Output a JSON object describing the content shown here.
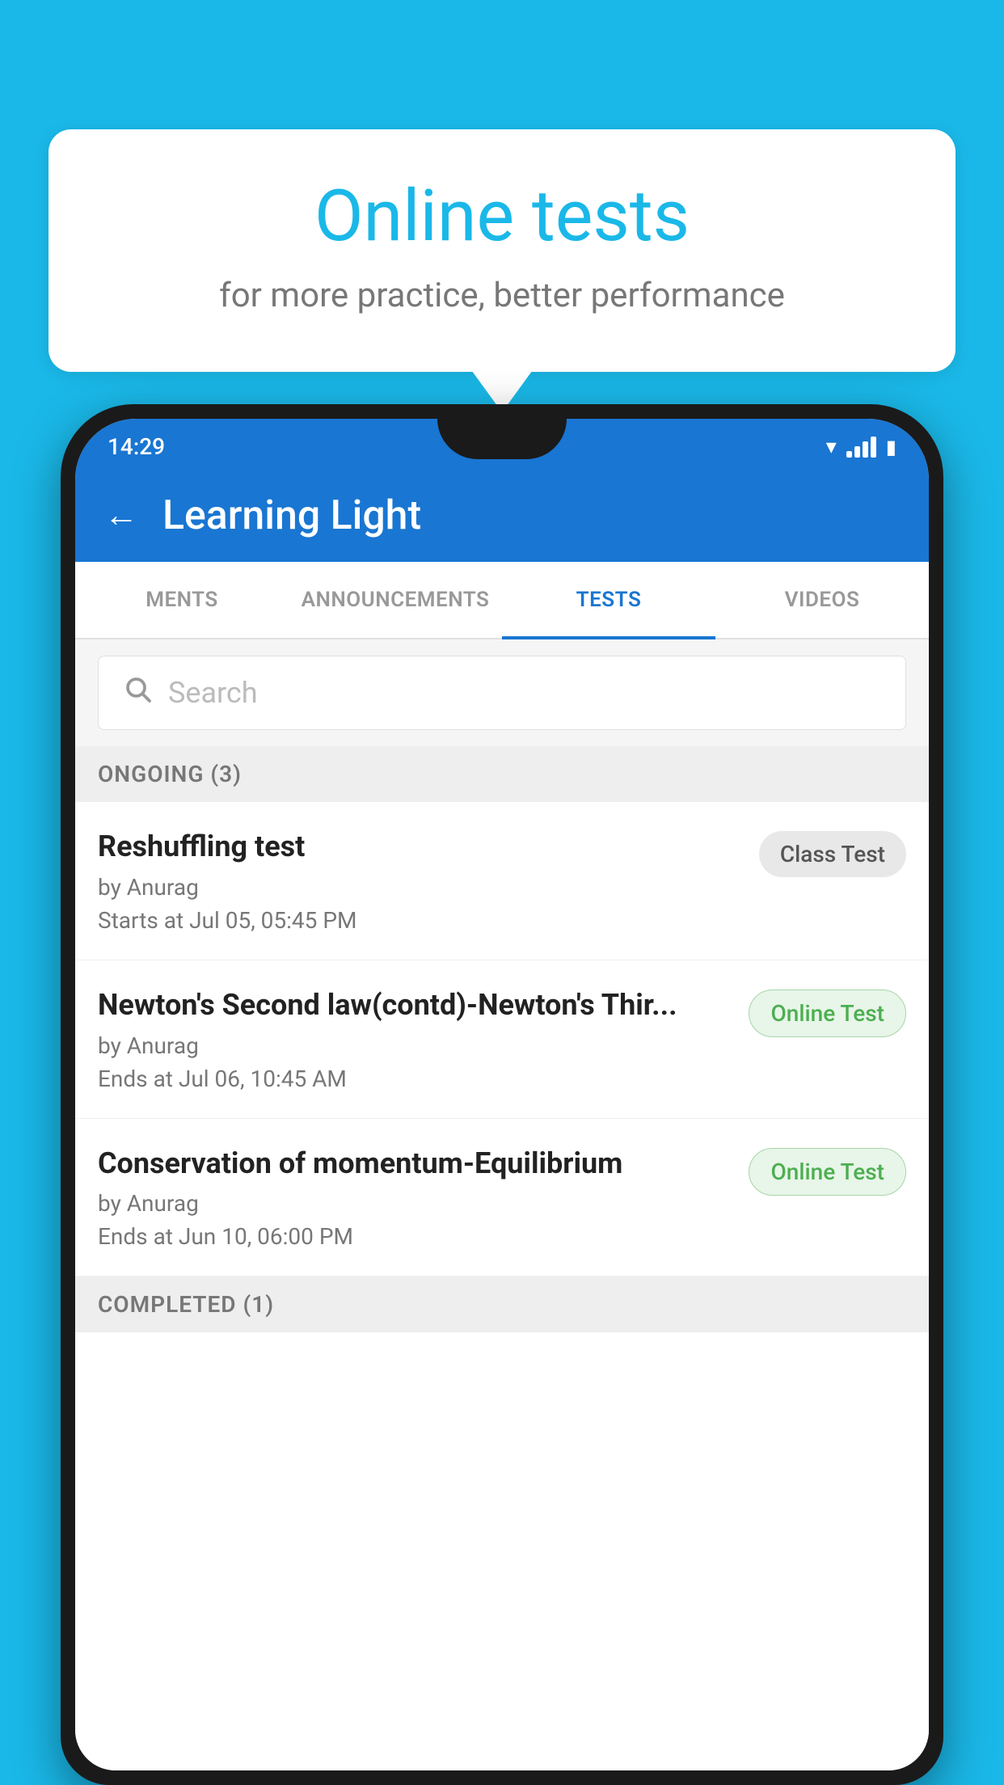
{
  "background_color": "#1ab8e8",
  "speech_bubble": {
    "title": "Online tests",
    "subtitle": "for more practice, better performance"
  },
  "phone": {
    "status_bar": {
      "time": "14:29",
      "wifi": "▾",
      "battery": "▮"
    },
    "app_bar": {
      "title": "Learning Light",
      "back_label": "←"
    },
    "tabs": [
      {
        "label": "MENTS",
        "active": false
      },
      {
        "label": "ANNOUNCEMENTS",
        "active": false
      },
      {
        "label": "TESTS",
        "active": true
      },
      {
        "label": "VIDEOS",
        "active": false
      }
    ],
    "search": {
      "placeholder": "Search"
    },
    "ongoing_section": {
      "header": "ONGOING (3)",
      "items": [
        {
          "name": "Reshuffling test",
          "author": "by Anurag",
          "time_label": "Starts at",
          "time": "Jul 05, 05:45 PM",
          "badge": "Class Test",
          "badge_type": "class"
        },
        {
          "name": "Newton's Second law(contd)-Newton's Thir...",
          "author": "by Anurag",
          "time_label": "Ends at",
          "time": "Jul 06, 10:45 AM",
          "badge": "Online Test",
          "badge_type": "online"
        },
        {
          "name": "Conservation of momentum-Equilibrium",
          "author": "by Anurag",
          "time_label": "Ends at",
          "time": "Jun 10, 06:00 PM",
          "badge": "Online Test",
          "badge_type": "online"
        }
      ]
    },
    "completed_section": {
      "header": "COMPLETED (1)"
    }
  }
}
